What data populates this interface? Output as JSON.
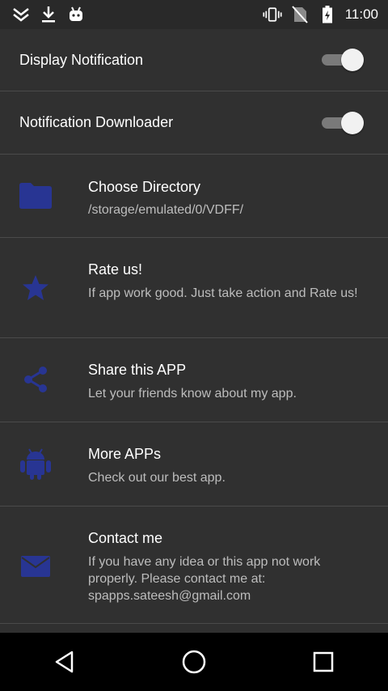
{
  "status_bar": {
    "time": "11:00",
    "icons": [
      "chevrons-down-icon",
      "download-icon",
      "android-icon",
      "vibrate-icon",
      "no-sim-icon",
      "battery-icon"
    ]
  },
  "settings": {
    "display_notification": {
      "label": "Display Notification",
      "enabled": true
    },
    "notification_downloader": {
      "label": "Notification Downloader",
      "enabled": true
    }
  },
  "items": [
    {
      "icon": "folder-icon",
      "title": "Choose Directory",
      "subtitle": "/storage/emulated/0/VDFF/"
    },
    {
      "icon": "star-icon",
      "title": "Rate us!",
      "subtitle": "If app work good. Just take action and Rate us!"
    },
    {
      "icon": "share-icon",
      "title": "Share this APP",
      "subtitle": "Let your friends know about my app."
    },
    {
      "icon": "android-icon",
      "title": "More APPs",
      "subtitle": "Check out our best app."
    },
    {
      "icon": "mail-icon",
      "title": "Contact me",
      "subtitle": "If you have any idea or this app not work properly. Please contact me at: spapps.sateesh@gmail.com"
    }
  ],
  "nav_bar": {
    "buttons": [
      "back-icon",
      "home-icon",
      "recents-icon"
    ]
  },
  "colors": {
    "icon_accent": "#283593",
    "background": "#303030",
    "divider": "#4a4a4a"
  }
}
